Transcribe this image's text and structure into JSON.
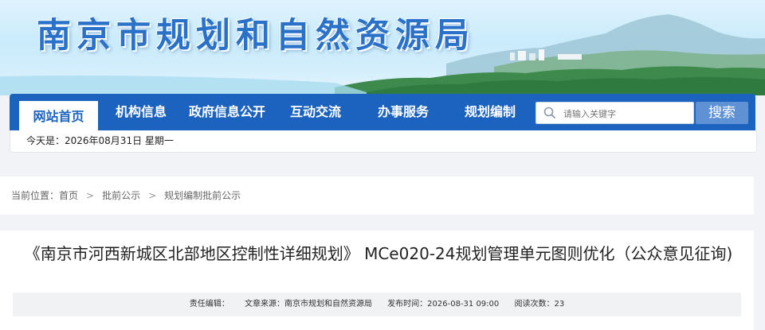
{
  "banner": {
    "title": "南京市规划和自然资源局"
  },
  "nav": {
    "items": [
      {
        "label": "网站首页",
        "active": true
      },
      {
        "label": "机构信息"
      },
      {
        "label": "政府信息公开"
      },
      {
        "label": "互动交流"
      },
      {
        "label": "办事服务"
      },
      {
        "label": "规划编制"
      }
    ],
    "search_placeholder": "请输入关键字",
    "search_button": "搜索"
  },
  "date_bar": {
    "text": "今天是：2026年08月31日 星期一"
  },
  "breadcrumb": {
    "prefix": "当前位置：",
    "items": [
      "首页",
      "批前公示",
      "规划编制批前公示"
    ],
    "separator": ">"
  },
  "article": {
    "title": "《南京市河西新城区北部地区控制性详细规划》 MCe020-24规划管理单元图则优化（公众意见征询)",
    "meta": {
      "editor": "责任编辑：",
      "source": "文章来源：南京市规划和自然资源局",
      "published": "发布时间：2026-08-31 09:00",
      "views": "阅读次数：23"
    }
  },
  "colors": {
    "nav_blue": "#1b63bf",
    "search_button": "#5f92d4",
    "title_blue": "#2a72c9"
  }
}
